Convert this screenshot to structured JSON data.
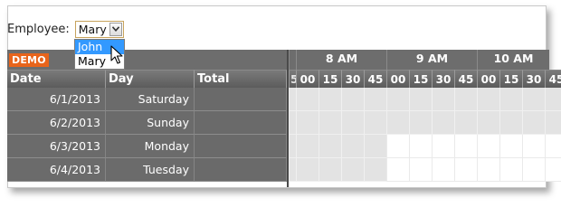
{
  "employee": {
    "label": "Employee:",
    "selected": "Mary",
    "options": [
      "John",
      "Mary"
    ],
    "highlighted": "John"
  },
  "scheduler": {
    "badge": "DEMO",
    "columns": [
      "Date",
      "Day",
      "Total"
    ],
    "hours": [
      "8 AM",
      "9 AM",
      "10 AM"
    ],
    "minute_labels": [
      "00",
      "15",
      "30",
      "45"
    ],
    "partial_minute": "5",
    "rows": [
      {
        "date": "6/1/2013",
        "day": "Saturday",
        "total": ""
      },
      {
        "date": "6/2/2013",
        "day": "Sunday",
        "total": ""
      },
      {
        "date": "6/3/2013",
        "day": "Monday",
        "total": ""
      },
      {
        "date": "6/4/2013",
        "day": "Tuesday",
        "total": ""
      }
    ],
    "colors": {
      "header": "#6d6d6d",
      "badge": "#e8641b",
      "nonbusiness": "#e3e3e3",
      "business": "#ffffff",
      "highlight": "#3399ff"
    }
  }
}
